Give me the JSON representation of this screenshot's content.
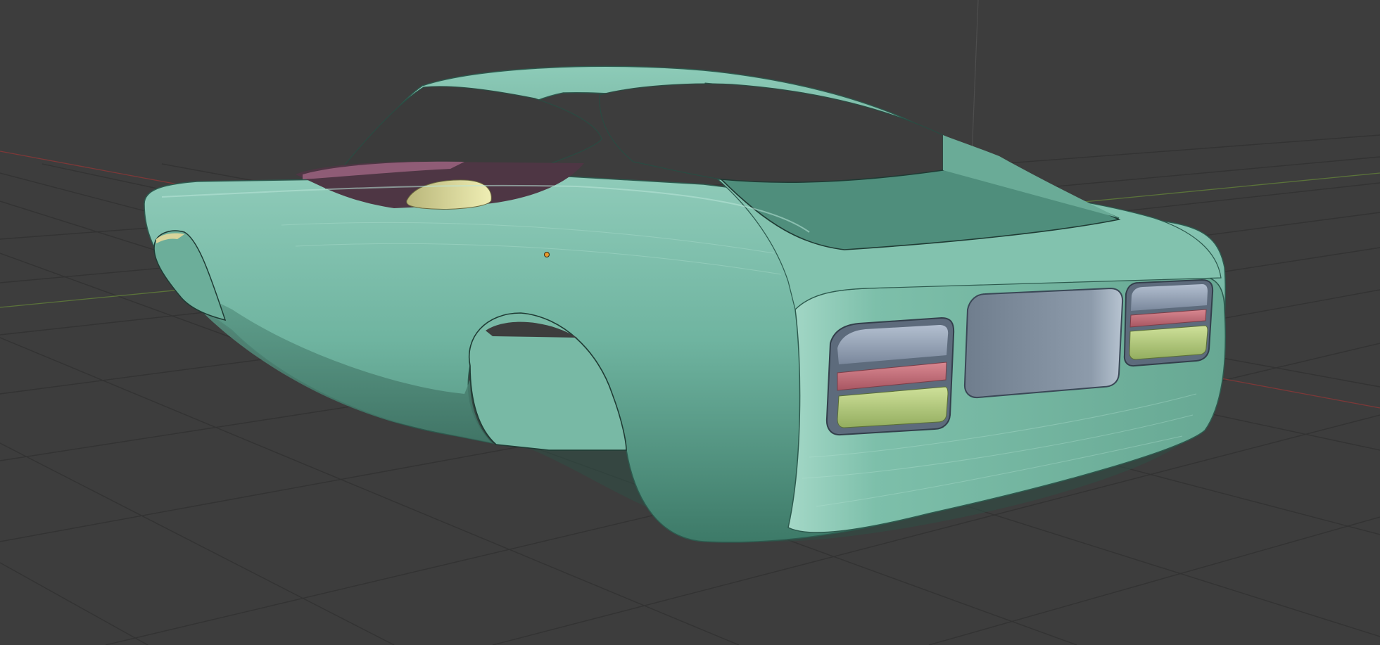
{
  "viewport": {
    "background": "#3d3d3d",
    "grid_color": "#2f2f2f",
    "x_axis_color": "#8a3a3a",
    "y_axis_color": "#5f7a3a",
    "z_axis_color": "#555555",
    "object_origin_color": "#e89a2c"
  },
  "model": {
    "body_color": "#6fb4a0",
    "body_highlight": "#a8dccb",
    "body_shadow": "#3f7c6c",
    "window_color": "#3a3a3a",
    "interior_color": "#5a3b4a",
    "seat_color": "#d7d69a",
    "lamp_red": "#c6707a",
    "lamp_green": "#b6cf7f",
    "lamp_housing": "#7f8da0"
  }
}
